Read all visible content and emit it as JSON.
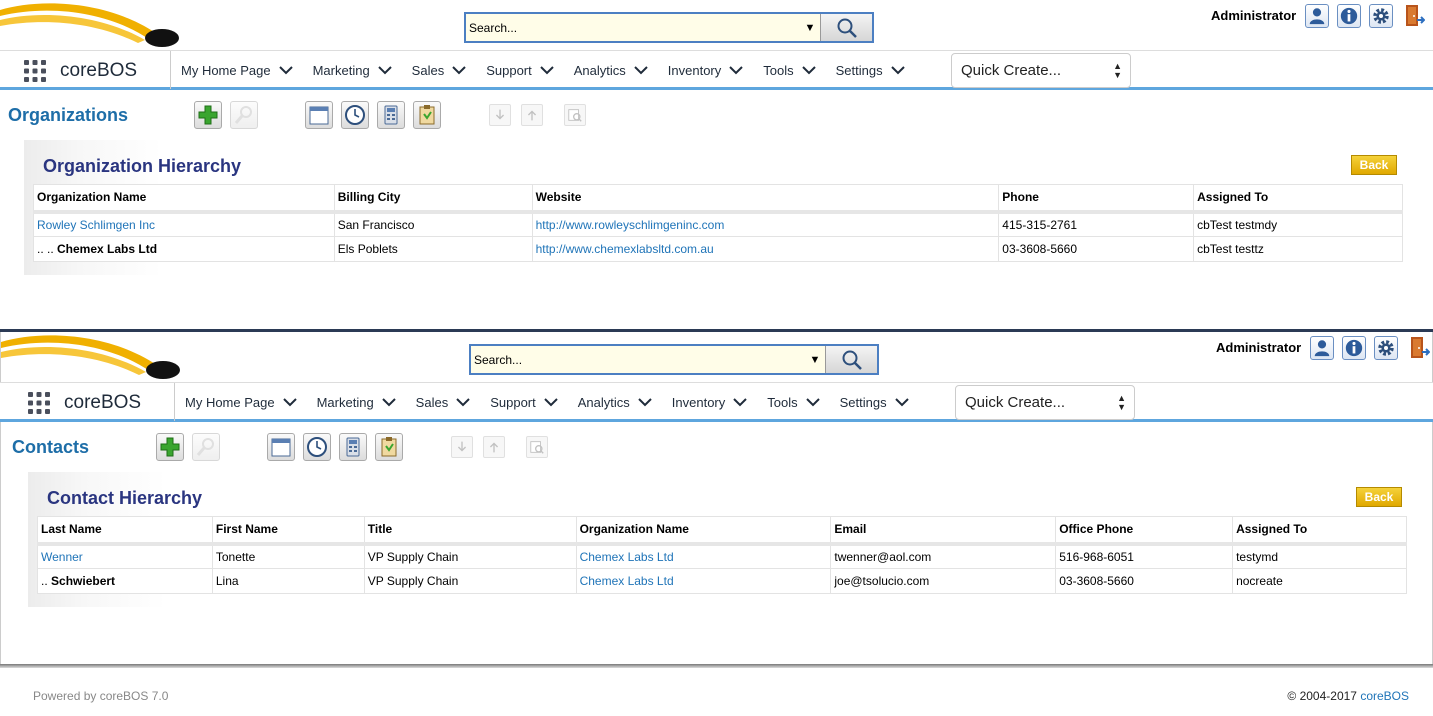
{
  "header": {
    "search_placeholder": "Search...",
    "user_label": "Administrator"
  },
  "nav": {
    "brand": "coreBOS",
    "items": [
      "My Home Page",
      "Marketing",
      "Sales",
      "Support",
      "Analytics",
      "Inventory",
      "Tools",
      "Settings"
    ],
    "quick_create": "Quick Create..."
  },
  "icons": {
    "logo": "corebos-swoosh-logo",
    "search": "search-icon",
    "user": "user-icon",
    "info": "info-icon",
    "settings": "gear-icon",
    "logout": "exit-door-icon",
    "apps": "apps-grid-icon",
    "accent": "#1e6ea8",
    "title_color": "#2a3580",
    "back_color": "#e8b400"
  },
  "screen1": {
    "module_title": "Organizations",
    "panel_title": "Organization Hierarchy",
    "back_label": "Back",
    "columns": [
      "Organization Name",
      "Billing City",
      "Website",
      "Phone",
      "Assigned To"
    ],
    "rows": [
      {
        "prefix": "",
        "name": "Rowley Schlimgen Inc",
        "city": "San Francisco",
        "website": "http://www.rowleyschlimgeninc.com",
        "phone": "415-315-2761",
        "assigned": "cbTest testmdy"
      },
      {
        "prefix": ".. .. ",
        "name": "Chemex Labs Ltd",
        "city": "Els Poblets",
        "website": "http://www.chemexlabsltd.com.au",
        "phone": "03-3608-5660",
        "assigned": "cbTest testtz"
      }
    ]
  },
  "screen2": {
    "module_title": "Contacts",
    "panel_title": "Contact Hierarchy",
    "back_label": "Back",
    "columns": [
      "Last Name",
      "First Name",
      "Title",
      "Organization Name",
      "Email",
      "Office Phone",
      "Assigned To"
    ],
    "rows": [
      {
        "prefix": "",
        "last": "Wenner",
        "first": "Tonette",
        "title": "VP Supply Chain",
        "org": "Chemex Labs Ltd",
        "email": "twenner@aol.com",
        "phone": "516-968-6051",
        "assigned": "testymd"
      },
      {
        "prefix": ".. ",
        "last": "Schwiebert",
        "first": "Lina",
        "title": "VP Supply Chain",
        "org": "Chemex Labs Ltd",
        "email": "joe@tsolucio.com",
        "phone": "03-3608-5660",
        "assigned": "nocreate"
      }
    ]
  },
  "footer": {
    "powered": "Powered by coreBOS 7.0",
    "copyright": "© 2004-2017 ",
    "copyright_link": "coreBOS"
  }
}
